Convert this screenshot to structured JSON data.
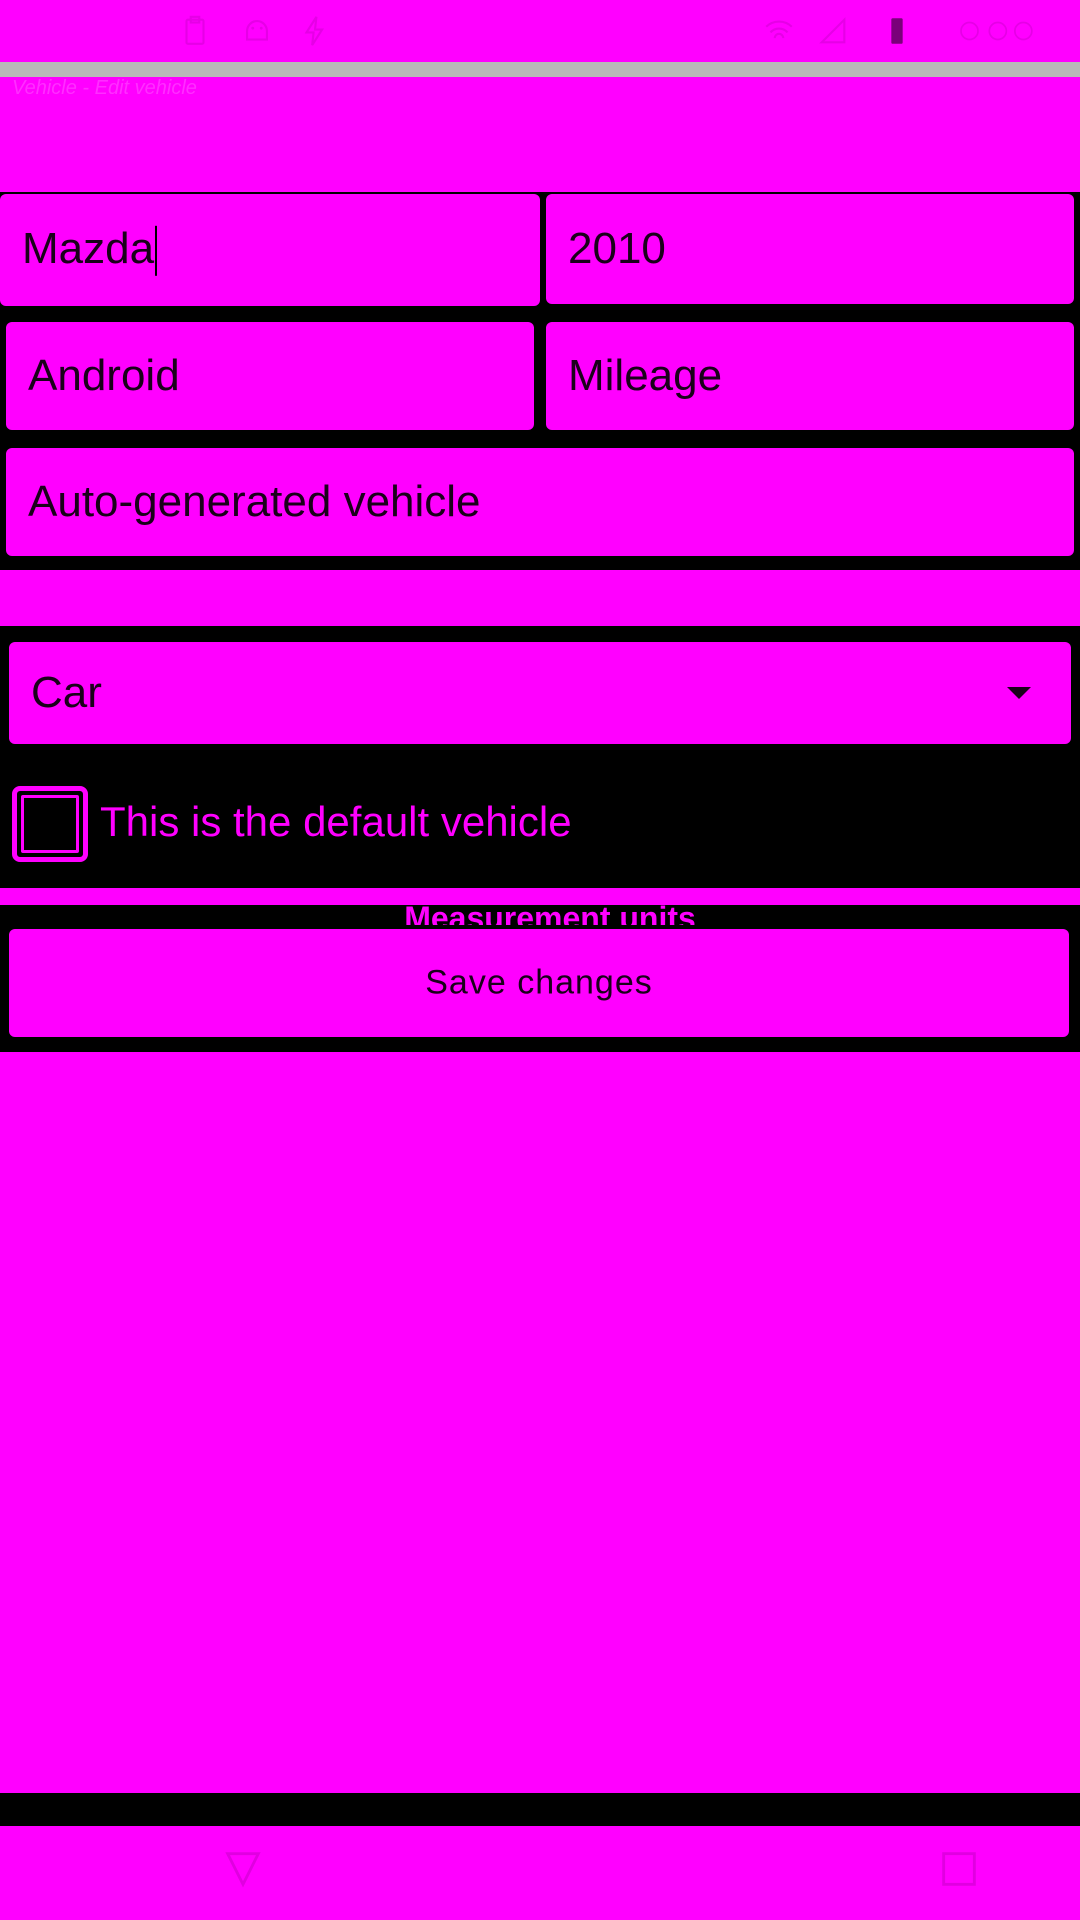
{
  "status_bar": {
    "icons": [
      "clipboard-icon",
      "android-icon",
      "bolt-icon",
      "wifi-icon",
      "signal-icon",
      "battery-icon"
    ]
  },
  "app_bar": {
    "subtitle": "Vehicle - Edit vehicle"
  },
  "form": {
    "make_value": "Mazda",
    "year_value": "2010",
    "model_value": "Android",
    "mileage_placeholder": "Mileage",
    "description_value": "Auto-generated vehicle",
    "vehicle_type_selected": "Car",
    "default_checkbox_label": "This is the default vehicle",
    "default_checked": false,
    "measurement_units_label": "Measurement units",
    "save_button_label": "Save changes"
  },
  "nav_bar": {
    "icons": [
      "back-icon",
      "recents-icon"
    ]
  },
  "colors": {
    "background": "#ff00ff",
    "form_background": "#000000",
    "text": "#1a001a"
  }
}
